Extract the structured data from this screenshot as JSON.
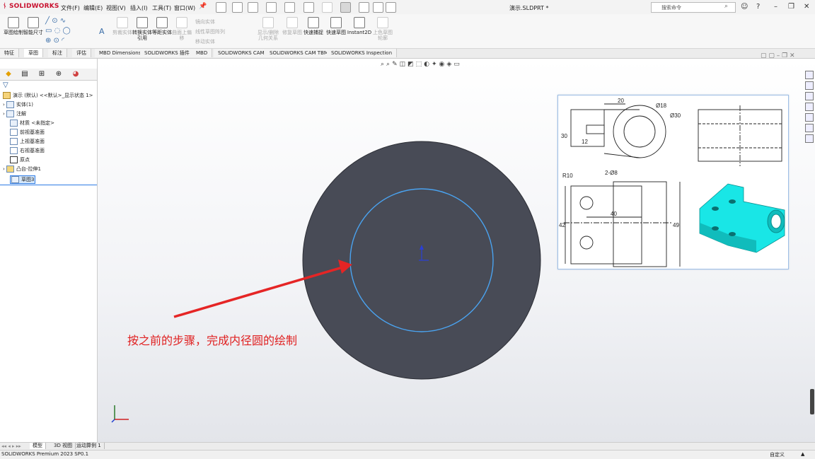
{
  "app": {
    "brand": "SOLIDWORKS",
    "window_title": "演示.SLDPRT *",
    "status_text": "SOLIDWORKS Premium 2023 SP0.1",
    "status_right": "自定义"
  },
  "menu": [
    "文件(F)",
    "编辑(E)",
    "视图(V)",
    "插入(I)",
    "工具(T)",
    "窗口(W)"
  ],
  "search": {
    "placeholder": "搜索命令"
  },
  "commands": [
    {
      "label": "草图绘制",
      "enabled": true
    },
    {
      "label": "智能尺寸",
      "enabled": true
    },
    {
      "label": "剪裁实体",
      "enabled": false
    },
    {
      "label": "转换实体引用",
      "enabled": true
    },
    {
      "label": "等距实体",
      "enabled": true
    },
    {
      "label": "曲面上偏移",
      "enabled": false
    },
    {
      "label": "显示/删除几何关系",
      "enabled": false
    },
    {
      "label": "修复草图",
      "enabled": false
    },
    {
      "label": "快速捕捉",
      "enabled": true
    },
    {
      "label": "快速草图",
      "enabled": true
    },
    {
      "label": "Instant2D",
      "enabled": true
    },
    {
      "label": "上色草图轮廓",
      "enabled": false
    }
  ],
  "command_small": [
    "镜向实体",
    "线性草图阵列",
    "移动实体"
  ],
  "tabs": [
    "特征",
    "草图",
    "标注",
    "评估",
    "MBD Dimensions",
    "SOLIDWORKS 插件",
    "MBD",
    "SOLIDWORKS CAM",
    "SOLIDWORKS CAM TBM",
    "SOLIDWORKS Inspection"
  ],
  "active_tab": "草图",
  "tree": {
    "root": "演示 (默认) <<默认>_显示状态 1>",
    "items": [
      "实体(1)",
      "注解",
      "材质 <未指定>",
      "前视基准面",
      "上视基准面",
      "右视基准面",
      "原点",
      "凸台-拉伸1",
      "草图3"
    ],
    "selected": "草图3"
  },
  "bottom_tabs": [
    "模型",
    "3D 视图",
    "运动算例 1"
  ],
  "caption": "按之前的步骤，完成内径圆的绘制",
  "drawing": {
    "dims": [
      "20",
      "Ø18",
      "Ø30",
      "30",
      "12",
      "R10",
      "2-Ø8",
      "40",
      "42",
      "49"
    ]
  },
  "colors": {
    "disk": "#484b56",
    "sketch_circle": "#4aa3f0",
    "arrow": "#e52525",
    "part": "#19e6e6"
  }
}
